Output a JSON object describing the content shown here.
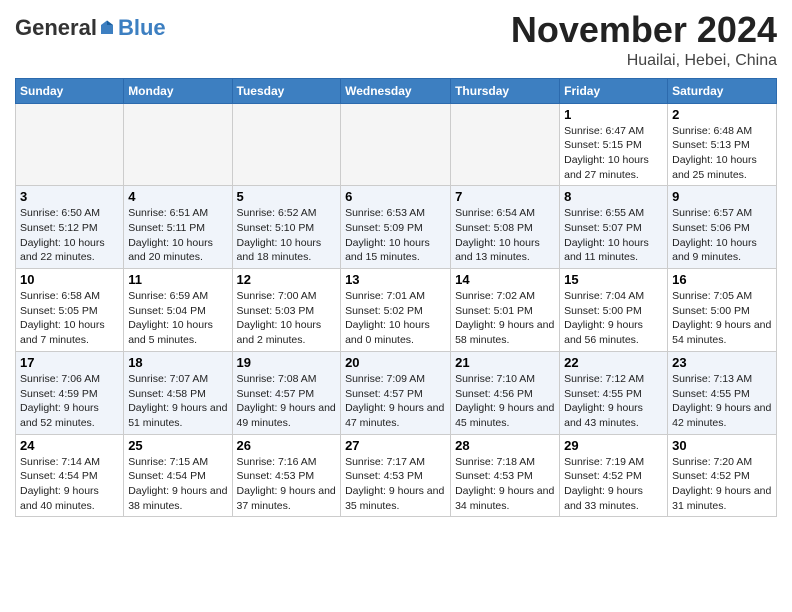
{
  "header": {
    "logo_general": "General",
    "logo_blue": "Blue",
    "month_title": "November 2024",
    "location": "Huailai, Hebei, China"
  },
  "weekdays": [
    "Sunday",
    "Monday",
    "Tuesday",
    "Wednesday",
    "Thursday",
    "Friday",
    "Saturday"
  ],
  "weeks": [
    [
      {
        "day": "",
        "empty": true
      },
      {
        "day": "",
        "empty": true
      },
      {
        "day": "",
        "empty": true
      },
      {
        "day": "",
        "empty": true
      },
      {
        "day": "",
        "empty": true
      },
      {
        "day": "1",
        "sunrise": "6:47 AM",
        "sunset": "5:15 PM",
        "daylight": "10 hours and 27 minutes."
      },
      {
        "day": "2",
        "sunrise": "6:48 AM",
        "sunset": "5:13 PM",
        "daylight": "10 hours and 25 minutes."
      }
    ],
    [
      {
        "day": "3",
        "sunrise": "6:50 AM",
        "sunset": "5:12 PM",
        "daylight": "10 hours and 22 minutes."
      },
      {
        "day": "4",
        "sunrise": "6:51 AM",
        "sunset": "5:11 PM",
        "daylight": "10 hours and 20 minutes."
      },
      {
        "day": "5",
        "sunrise": "6:52 AM",
        "sunset": "5:10 PM",
        "daylight": "10 hours and 18 minutes."
      },
      {
        "day": "6",
        "sunrise": "6:53 AM",
        "sunset": "5:09 PM",
        "daylight": "10 hours and 15 minutes."
      },
      {
        "day": "7",
        "sunrise": "6:54 AM",
        "sunset": "5:08 PM",
        "daylight": "10 hours and 13 minutes."
      },
      {
        "day": "8",
        "sunrise": "6:55 AM",
        "sunset": "5:07 PM",
        "daylight": "10 hours and 11 minutes."
      },
      {
        "day": "9",
        "sunrise": "6:57 AM",
        "sunset": "5:06 PM",
        "daylight": "10 hours and 9 minutes."
      }
    ],
    [
      {
        "day": "10",
        "sunrise": "6:58 AM",
        "sunset": "5:05 PM",
        "daylight": "10 hours and 7 minutes."
      },
      {
        "day": "11",
        "sunrise": "6:59 AM",
        "sunset": "5:04 PM",
        "daylight": "10 hours and 5 minutes."
      },
      {
        "day": "12",
        "sunrise": "7:00 AM",
        "sunset": "5:03 PM",
        "daylight": "10 hours and 2 minutes."
      },
      {
        "day": "13",
        "sunrise": "7:01 AM",
        "sunset": "5:02 PM",
        "daylight": "10 hours and 0 minutes."
      },
      {
        "day": "14",
        "sunrise": "7:02 AM",
        "sunset": "5:01 PM",
        "daylight": "9 hours and 58 minutes."
      },
      {
        "day": "15",
        "sunrise": "7:04 AM",
        "sunset": "5:00 PM",
        "daylight": "9 hours and 56 minutes."
      },
      {
        "day": "16",
        "sunrise": "7:05 AM",
        "sunset": "5:00 PM",
        "daylight": "9 hours and 54 minutes."
      }
    ],
    [
      {
        "day": "17",
        "sunrise": "7:06 AM",
        "sunset": "4:59 PM",
        "daylight": "9 hours and 52 minutes."
      },
      {
        "day": "18",
        "sunrise": "7:07 AM",
        "sunset": "4:58 PM",
        "daylight": "9 hours and 51 minutes."
      },
      {
        "day": "19",
        "sunrise": "7:08 AM",
        "sunset": "4:57 PM",
        "daylight": "9 hours and 49 minutes."
      },
      {
        "day": "20",
        "sunrise": "7:09 AM",
        "sunset": "4:57 PM",
        "daylight": "9 hours and 47 minutes."
      },
      {
        "day": "21",
        "sunrise": "7:10 AM",
        "sunset": "4:56 PM",
        "daylight": "9 hours and 45 minutes."
      },
      {
        "day": "22",
        "sunrise": "7:12 AM",
        "sunset": "4:55 PM",
        "daylight": "9 hours and 43 minutes."
      },
      {
        "day": "23",
        "sunrise": "7:13 AM",
        "sunset": "4:55 PM",
        "daylight": "9 hours and 42 minutes."
      }
    ],
    [
      {
        "day": "24",
        "sunrise": "7:14 AM",
        "sunset": "4:54 PM",
        "daylight": "9 hours and 40 minutes."
      },
      {
        "day": "25",
        "sunrise": "7:15 AM",
        "sunset": "4:54 PM",
        "daylight": "9 hours and 38 minutes."
      },
      {
        "day": "26",
        "sunrise": "7:16 AM",
        "sunset": "4:53 PM",
        "daylight": "9 hours and 37 minutes."
      },
      {
        "day": "27",
        "sunrise": "7:17 AM",
        "sunset": "4:53 PM",
        "daylight": "9 hours and 35 minutes."
      },
      {
        "day": "28",
        "sunrise": "7:18 AM",
        "sunset": "4:53 PM",
        "daylight": "9 hours and 34 minutes."
      },
      {
        "day": "29",
        "sunrise": "7:19 AM",
        "sunset": "4:52 PM",
        "daylight": "9 hours and 33 minutes."
      },
      {
        "day": "30",
        "sunrise": "7:20 AM",
        "sunset": "4:52 PM",
        "daylight": "9 hours and 31 minutes."
      }
    ]
  ]
}
